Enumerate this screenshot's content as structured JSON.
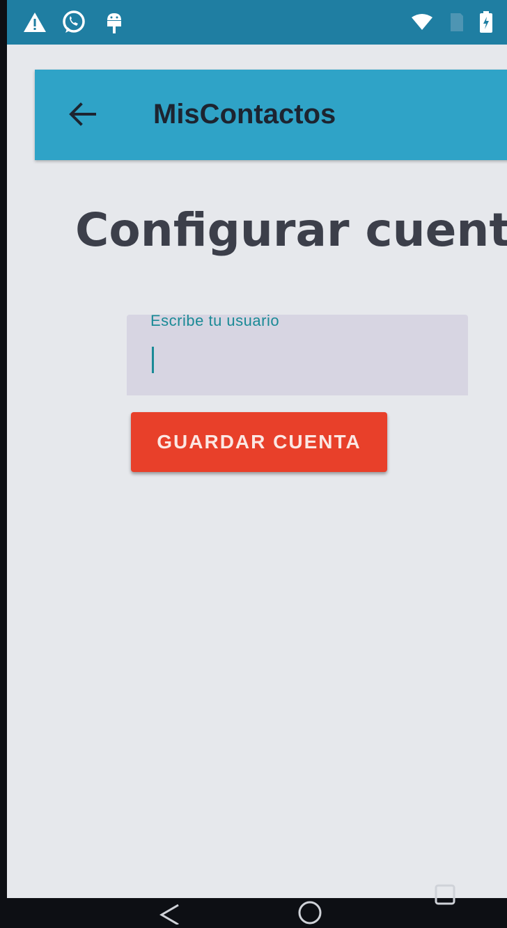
{
  "status_bar": {
    "icons": [
      "warning-icon",
      "whatsapp-icon",
      "android-debug-icon",
      "wifi-icon",
      "no-sim-icon",
      "battery-icon"
    ],
    "background": "#1f7ea2"
  },
  "app_bar": {
    "title": "MisContactos",
    "back_icon": "arrow-left-icon",
    "background": "#2fa3c7"
  },
  "main": {
    "page_title": "Configurar cuenta",
    "username_input": {
      "label": "Escribe tu usuario",
      "value": ""
    },
    "save_button_label": "GUARDAR CUENTA",
    "button_color": "#e8402a"
  },
  "nav_bar": {
    "buttons": [
      "back-triangle-icon",
      "home-circle-icon",
      "recents-square-icon"
    ]
  }
}
